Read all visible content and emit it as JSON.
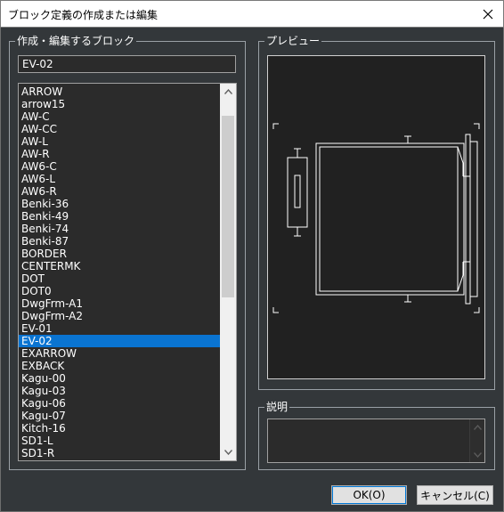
{
  "window": {
    "title": "ブロック定義の作成または編集"
  },
  "block_group": {
    "legend": "作成・編集するブロック",
    "name_value": "EV-02",
    "items": [
      "ARROW",
      "arrow15",
      "AW-C",
      "AW-CC",
      "AW-L",
      "AW-R",
      "AW6-C",
      "AW6-L",
      "AW6-R",
      "Benki-36",
      "Benki-49",
      "Benki-74",
      "Benki-87",
      "BORDER",
      "CENTERMK",
      "DOT",
      "DOT0",
      "DwgFrm-A1",
      "DwgFrm-A2",
      "EV-01",
      "EV-02",
      "EXARROW",
      "EXBACK",
      "Kagu-00",
      "Kagu-03",
      "Kagu-06",
      "Kagu-07",
      "Kitch-16",
      "SD1-L",
      "SD1-R"
    ],
    "selected": "EV-02"
  },
  "preview_group": {
    "legend": "プレビュー"
  },
  "description_group": {
    "legend": "説明",
    "value": ""
  },
  "buttons": {
    "ok": "OK(O)",
    "cancel": "キャンセル(C)"
  },
  "icons": {
    "close": "close-icon",
    "scroll_up": "chevron-up-icon",
    "scroll_down": "chevron-down-icon"
  },
  "colors": {
    "selection": "#0a74d1",
    "dialog_bg": "#33373a",
    "preview_bg": "#212121"
  }
}
